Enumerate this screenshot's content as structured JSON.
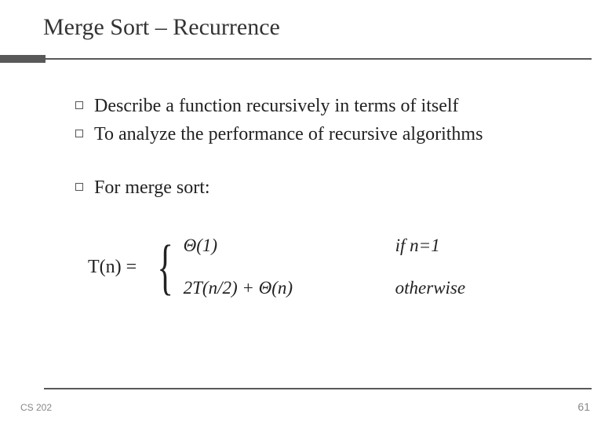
{
  "title": "Merge Sort – Recurrence",
  "bullets": {
    "b1": "Describe a function recursively in terms of itself",
    "b2": "To analyze the performance of recursive algorithms",
    "b3": "For merge sort:"
  },
  "recurrence": {
    "lhs": "T(n) =",
    "case1_expr": "Θ(1)",
    "case1_cond": "if n=1",
    "case2_expr": "2T(n/2) + Θ(n)",
    "case2_cond": "otherwise"
  },
  "footer": {
    "left": "CS 202",
    "right": "61"
  }
}
